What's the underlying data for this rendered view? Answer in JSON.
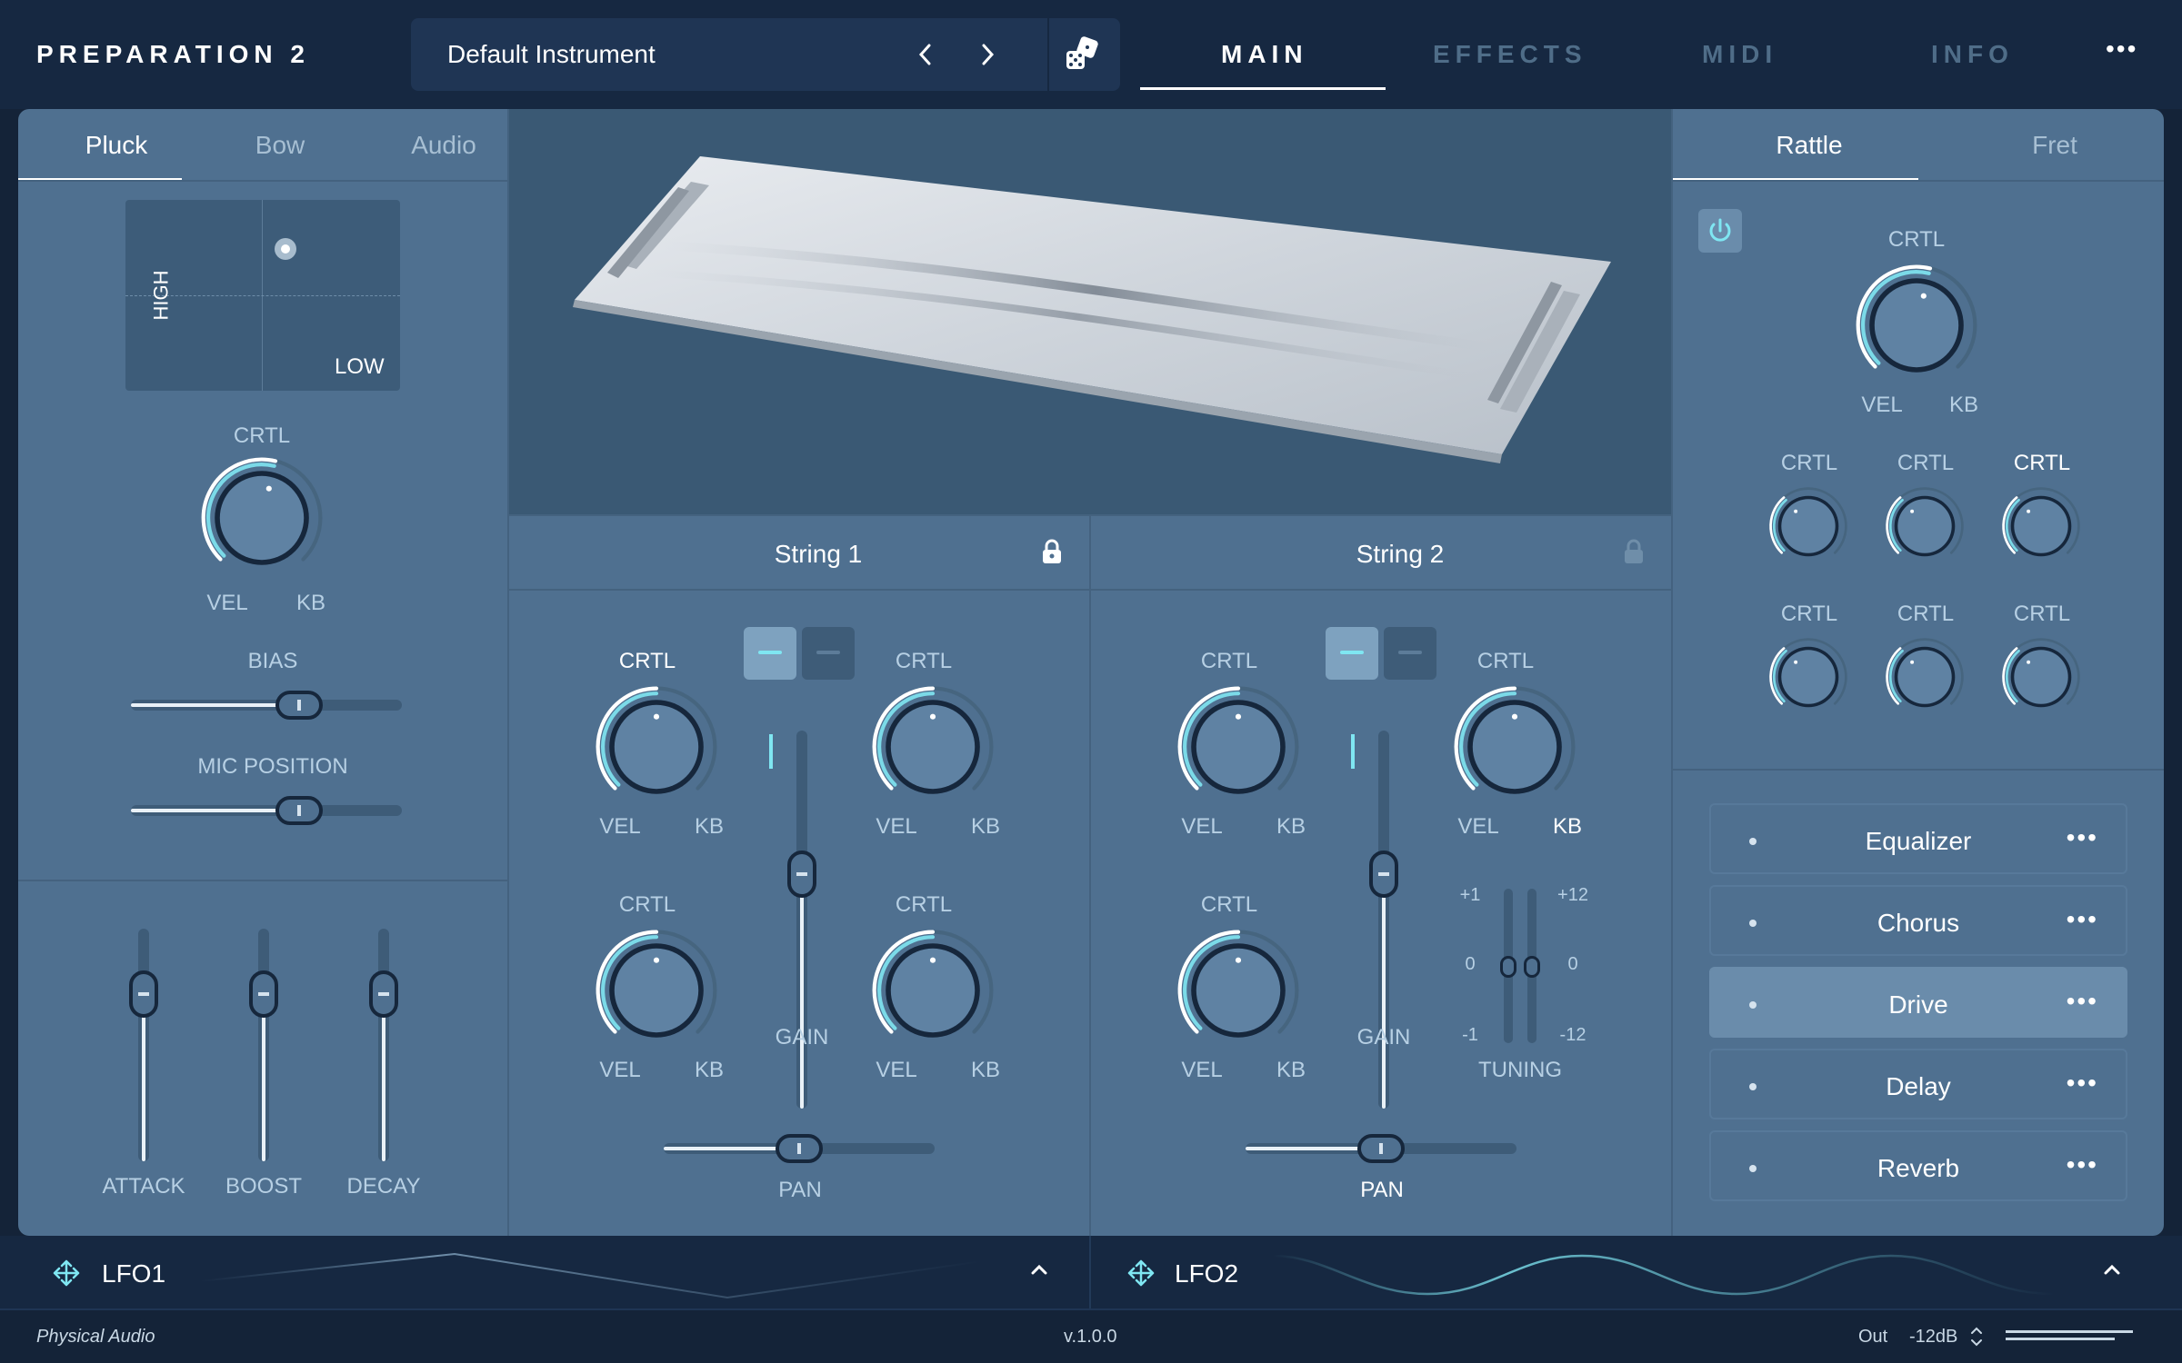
{
  "app": {
    "title": "PREPARATION 2"
  },
  "preset": {
    "name": "Default Instrument"
  },
  "top_tabs": [
    {
      "label": "MAIN",
      "active": true
    },
    {
      "label": "EFFECTS",
      "active": false
    },
    {
      "label": "MIDI",
      "active": false
    },
    {
      "label": "INFO",
      "active": false
    }
  ],
  "header": {
    "more": "•••"
  },
  "left": {
    "tabs": [
      {
        "label": "Pluck",
        "active": true
      },
      {
        "label": "Bow",
        "active": false
      },
      {
        "label": "Audio",
        "active": false
      }
    ],
    "xypad": {
      "y_label": "HIGH",
      "x_label": "LOW"
    },
    "knob": {
      "top": "CRTL",
      "left": "VEL",
      "right": "KB",
      "value": 0.55
    },
    "bias": {
      "label": "BIAS",
      "value": 0.62
    },
    "mic_position": {
      "label": "MIC POSITION",
      "value": 0.62
    },
    "envelope": [
      {
        "label": "ATTACK",
        "value": 0.72
      },
      {
        "label": "BOOST",
        "value": 0.72
      },
      {
        "label": "DECAY",
        "value": 0.72
      }
    ]
  },
  "strings": [
    {
      "title": "String 1",
      "locked": true,
      "knobs": [
        {
          "top": "CRTL",
          "left": "VEL",
          "right": "KB",
          "value": 0.5
        },
        {
          "top": "CRTL",
          "left": "VEL",
          "right": "KB",
          "value": 0.5
        },
        {
          "top": "CRTL",
          "left": "VEL",
          "right": "KB",
          "value": 0.5
        },
        {
          "top": "CRTL",
          "left": "VEL",
          "right": "KB",
          "value": 0.5
        }
      ],
      "gain": {
        "label": "GAIN",
        "value": 0.62
      },
      "pan": {
        "label": "PAN",
        "value": 0.5
      }
    },
    {
      "title": "String 2",
      "locked": false,
      "knobs": [
        {
          "top": "CRTL",
          "left": "VEL",
          "right": "KB",
          "value": 0.5
        },
        {
          "top": "CRTL",
          "left": "VEL",
          "right": "KB",
          "value": 0.5
        },
        {
          "top": "CRTL",
          "left": "VEL",
          "right": "KB",
          "value": 0.5
        }
      ],
      "gain": {
        "label": "GAIN",
        "value": 0.62
      },
      "pan": {
        "label": "PAN",
        "value": 0.5
      },
      "tuning": {
        "label": "TUNING",
        "fine": {
          "top": "+1",
          "mid": "0",
          "bottom": "-1"
        },
        "coarse": {
          "top": "+12",
          "mid": "0",
          "bottom": "-12"
        }
      }
    }
  ],
  "right": {
    "tabs": [
      {
        "label": "Rattle",
        "active": true
      },
      {
        "label": "Fret",
        "active": false
      }
    ],
    "main_knob": {
      "top": "CRTL",
      "left": "VEL",
      "right": "KB",
      "value": 0.55
    },
    "knob_label": "CRTL",
    "effects": [
      {
        "name": "Equalizer",
        "active": false
      },
      {
        "name": "Chorus",
        "active": false
      },
      {
        "name": "Drive",
        "active": true
      },
      {
        "name": "Delay",
        "active": false
      },
      {
        "name": "Reverb",
        "active": false
      }
    ],
    "more": "•••"
  },
  "lfo": [
    {
      "name": "LFO1"
    },
    {
      "name": "LFO2"
    }
  ],
  "status": {
    "brand": "Physical Audio",
    "version": "v.1.0.0",
    "out_label": "Out",
    "out_value": "-12dB"
  },
  "colors": {
    "accent": "#7fe6f2",
    "panel": "#4f7090",
    "header": "#162841"
  }
}
